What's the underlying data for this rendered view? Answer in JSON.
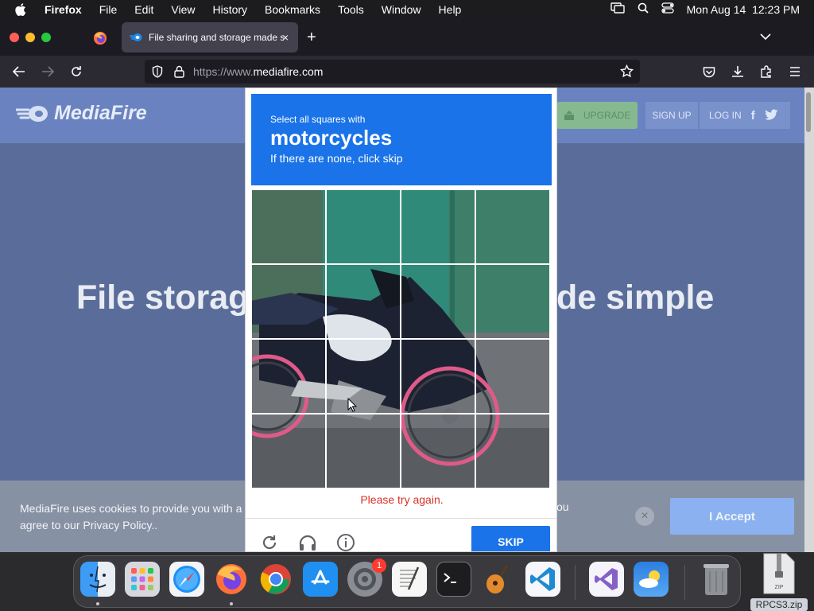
{
  "menubar": {
    "app_name": "Firefox",
    "menus": [
      "File",
      "Edit",
      "View",
      "History",
      "Bookmarks",
      "Tools",
      "Window",
      "Help"
    ],
    "clock": "Mon Aug 14  12:23 PM"
  },
  "browser": {
    "active_tab_title": "File sharing and storage made simple",
    "tab_close": "×",
    "new_tab": "+",
    "url_prefix": "https://www.",
    "url_domain": "mediafire.com"
  },
  "page": {
    "logo_text": "MediaFire",
    "upgrade_label": "UPGRADE",
    "signup_label": "SIGN UP",
    "login_label": "LOG IN",
    "hero_left": "File storag",
    "hero_right": "de simple",
    "cookie_line1": "MediaFire uses cookies to provide you with a p",
    "cookie_line2": "agree to our Privacy Policy..",
    "cookie_tail": "ou",
    "cookie_close": "×",
    "accept_label": "I Accept"
  },
  "captcha": {
    "instruction": "Select all squares with",
    "target": "motorcycles",
    "hint": "If there are none, click skip",
    "error": "Please try again.",
    "skip_label": "SKIP",
    "accent_color": "#1a73e8",
    "error_color": "#d93025"
  },
  "dock": {
    "apps": [
      "finder-icon",
      "launchpad-icon",
      "safari-icon",
      "firefox-icon",
      "chrome-icon",
      "app-store-icon",
      "system-settings-icon",
      "textedit-icon",
      "terminal-icon",
      "garageband-icon",
      "vscode-icon",
      "visual-studio-icon",
      "weather-icon",
      "trash-icon"
    ],
    "settings_badge": "1",
    "desktop_file_type": "ZIP",
    "desktop_file_name": "RPCS3.zip"
  }
}
